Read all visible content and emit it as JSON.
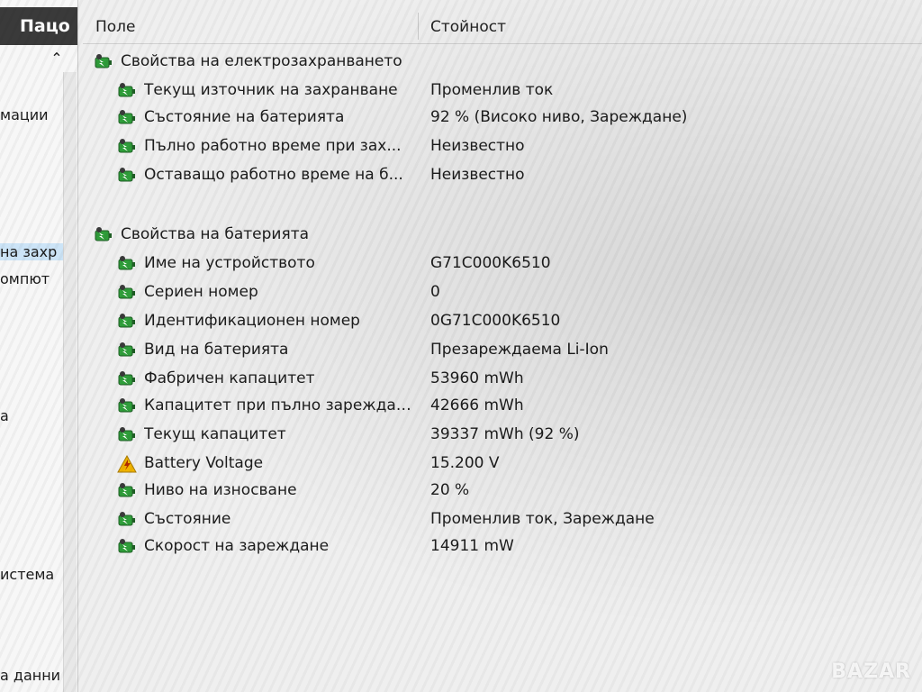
{
  "left": {
    "title": "Пацо",
    "items": [
      {
        "label": "мации",
        "selected": false
      },
      {
        "label": "на захр",
        "selected": true
      },
      {
        "label": "омпют",
        "selected": false
      },
      {
        "label": "а",
        "selected": false
      },
      {
        "label": "истема",
        "selected": false
      },
      {
        "label": "а данни",
        "selected": false
      }
    ]
  },
  "columns": {
    "field": "Поле",
    "value": "Стойност"
  },
  "power": {
    "group_label": "Свойства на електрозахранването",
    "rows": [
      {
        "field": "Текущ източник на захранване",
        "value": "Променлив ток"
      },
      {
        "field": "Състояние на батерията",
        "value": "92 % (Високо ниво, Зареждане)"
      },
      {
        "field": "Пълно работно време при зах...",
        "value": "Неизвестно"
      },
      {
        "field": "Оставащо работно време на б...",
        "value": "Неизвестно"
      }
    ]
  },
  "battery": {
    "group_label": "Свойства на батерията",
    "rows": [
      {
        "field": "Име на устройството",
        "value": "G71C000K6510",
        "icon": "battery-icon"
      },
      {
        "field": "Сериен номер",
        "value": "0",
        "icon": "battery-icon"
      },
      {
        "field": "Идентификационен номер",
        "value": "0G71C000K6510",
        "icon": "battery-icon"
      },
      {
        "field": "Вид на батерията",
        "value": "Презареждаема Li-Ion",
        "icon": "battery-icon"
      },
      {
        "field": "Фабричен капацитет",
        "value": "53960 mWh",
        "icon": "battery-icon"
      },
      {
        "field": "Капацитет при пълно зареждане",
        "value": "42666 mWh",
        "icon": "battery-icon"
      },
      {
        "field": "Текущ капацитет",
        "value": "39337 mWh  (92 %)",
        "icon": "battery-icon"
      },
      {
        "field": "Battery Voltage",
        "value": "15.200 V",
        "icon": "warning-icon"
      },
      {
        "field": "Ниво на износване",
        "value": "20 %",
        "icon": "battery-icon"
      },
      {
        "field": "Състояние",
        "value": "Променлив ток, Зареждане",
        "icon": "battery-icon"
      },
      {
        "field": "Скорост на зареждане",
        "value": "14911 mW",
        "icon": "battery-icon"
      }
    ]
  },
  "watermark": "BAZAR",
  "colors": {
    "battery_green": "#2f9e3a",
    "warning_yellow": "#f0b400",
    "selection": "#cce4f7"
  }
}
